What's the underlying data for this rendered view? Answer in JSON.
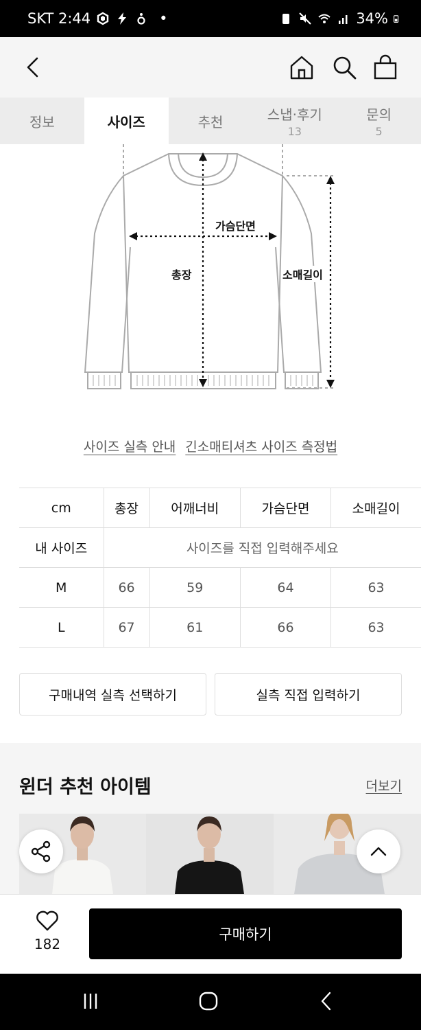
{
  "status_bar": {
    "carrier_time": "SKT 2:44",
    "dot": "•",
    "battery": "34%"
  },
  "header": {
    "back_icon": "back-arrow-icon",
    "home_icon": "home-icon",
    "search_icon": "search-icon",
    "cart_icon": "shopping-bag-icon"
  },
  "tabs": [
    {
      "label": "정보",
      "count": ""
    },
    {
      "label": "사이즈",
      "count": ""
    },
    {
      "label": "추천",
      "count": ""
    },
    {
      "label": "스냅·후기",
      "count": "13"
    },
    {
      "label": "문의",
      "count": "5"
    }
  ],
  "diagram": {
    "chest": "가슴단면",
    "length": "총장",
    "sleeve": "소매길이"
  },
  "guide_links": {
    "size_guide": "사이즈 실측 안내",
    "measure_method": "긴소매티셔츠 사이즈 측정법"
  },
  "size_table": {
    "unit": "cm",
    "columns": [
      "총장",
      "어깨너비",
      "가슴단면",
      "소매길이"
    ],
    "my_size_label": "내 사이즈",
    "my_size_placeholder": "사이즈를 직접 입력해주세요",
    "rows": [
      {
        "size": "M",
        "values": [
          "66",
          "59",
          "64",
          "63"
        ]
      },
      {
        "size": "L",
        "values": [
          "67",
          "61",
          "66",
          "63"
        ]
      }
    ]
  },
  "actions": {
    "select_history": "구매내역 실측 선택하기",
    "direct_input": "실측 직접 입력하기"
  },
  "recommend": {
    "title": "윈더 추천 아이템",
    "more": "더보기"
  },
  "buy_bar": {
    "likes": "182",
    "buy": "구매하기"
  },
  "colors": {
    "accent": "#000000",
    "tab_bg": "#ececec",
    "header_bg": "#f5f5f5"
  }
}
